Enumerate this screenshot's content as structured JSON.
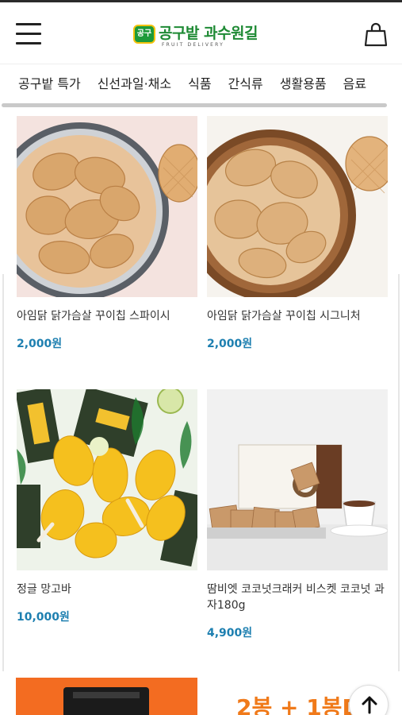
{
  "header": {
    "logo_text": "공구밭 과수원길",
    "logo_sub": "FRUIT DELIVERY",
    "logo_badge": "공구"
  },
  "nav": {
    "tabs": [
      "공구밭 특가",
      "신선과일·채소",
      "식품",
      "간식류",
      "생활용품",
      "음료"
    ]
  },
  "products": [
    {
      "name": "아임닭 닭가슴살 꾸이칩 스파이시",
      "price": "2,000원",
      "image": "chicken-chips-bowl-pink"
    },
    {
      "name": "아임닭 닭가슴살 꾸이칩 시그니처",
      "price": "2,000원",
      "image": "chicken-chips-bowl-wood"
    },
    {
      "name": "정글 망고바",
      "price": "10,000원",
      "image": "mango-ice-bars"
    },
    {
      "name": "땀비엣 코코넛크래커 비스켓 코코넛 과자180g",
      "price": "4,900원",
      "image": "coconut-cracker-box"
    }
  ],
  "banner": {
    "promo_text": "2봉 + 1봉D"
  },
  "colors": {
    "price": "#1d7fb0",
    "logo_green": "#1e8a34",
    "banner_orange": "#f36c21",
    "promo_orange": "#f07a1a"
  }
}
